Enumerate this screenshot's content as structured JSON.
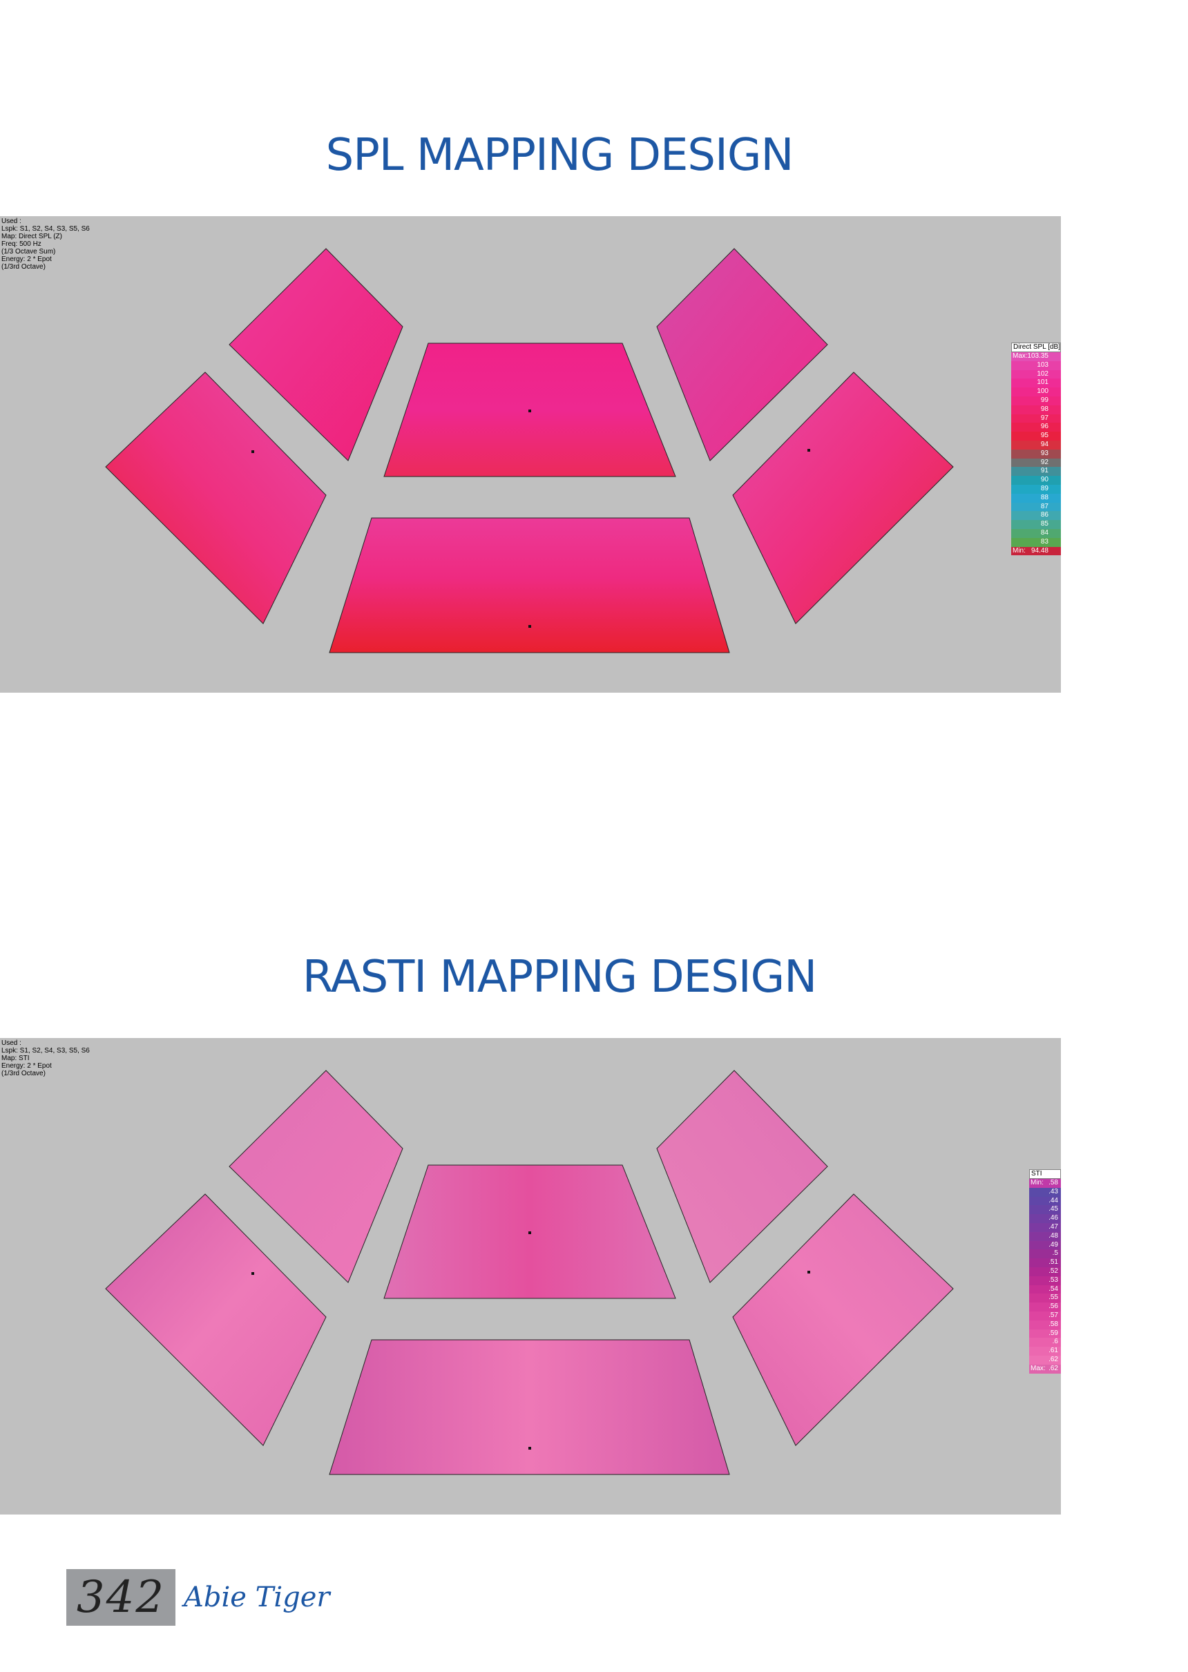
{
  "spl": {
    "title": "SPL MAPPING DESIGN",
    "info": [
      "Used :",
      "Lspk: S1, S2, S4, S3, S5, S6",
      "Map: Direct SPL (Z)",
      "Freq: 500 Hz",
      "(1/3 Octave Sum)",
      "Energy: 2 * Epot",
      "(1/3rd Octave)"
    ],
    "legend": {
      "title": "Direct SPL [dB]",
      "rows": [
        {
          "label": "Max:",
          "value": "103.35",
          "color": "#e34fb4"
        },
        {
          "label": "",
          "value": "103",
          "color": "#e840a8"
        },
        {
          "label": "",
          "value": "102",
          "color": "#ec36a0"
        },
        {
          "label": "",
          "value": "101",
          "color": "#ef2c96"
        },
        {
          "label": "",
          "value": "100",
          "color": "#f0288c"
        },
        {
          "label": "",
          "value": "99",
          "color": "#f02680"
        },
        {
          "label": "",
          "value": "98",
          "color": "#ef2470"
        },
        {
          "label": "",
          "value": "97",
          "color": "#ee2260"
        },
        {
          "label": "",
          "value": "96",
          "color": "#ec2050"
        },
        {
          "label": "",
          "value": "95",
          "color": "#e92040"
        },
        {
          "label": "",
          "value": "94",
          "color": "#d83040"
        },
        {
          "label": "",
          "value": "93",
          "color": "#a04a50"
        },
        {
          "label": "",
          "value": "92",
          "color": "#707070"
        },
        {
          "label": "",
          "value": "91",
          "color": "#40909a"
        },
        {
          "label": "",
          "value": "90",
          "color": "#20a0b0"
        },
        {
          "label": "",
          "value": "89",
          "color": "#20a8c4"
        },
        {
          "label": "",
          "value": "88",
          "color": "#28a8d0"
        },
        {
          "label": "",
          "value": "87",
          "color": "#30a8c8"
        },
        {
          "label": "",
          "value": "86",
          "color": "#40a8b0"
        },
        {
          "label": "",
          "value": "85",
          "color": "#48a890"
        },
        {
          "label": "",
          "value": "84",
          "color": "#50a870"
        },
        {
          "label": "",
          "value": "83",
          "color": "#58a850"
        },
        {
          "label": "Min:",
          "value": "94.48",
          "color": "#c8243c"
        }
      ]
    }
  },
  "rasti": {
    "title": "RASTI MAPPING DESIGN",
    "info": [
      "Used :",
      "Lspk: S1, S2, S4, S3, S5, S6",
      "Map: STI",
      "Energy: 2 * Epot",
      "(1/3rd Octave)"
    ],
    "legend": {
      "title": "STI",
      "rows": [
        {
          "label": "Min:",
          "value": ".58",
          "color": "#c03aa8"
        },
        {
          "label": "",
          "value": ".43",
          "color": "#5a4aa8"
        },
        {
          "label": "",
          "value": ".44",
          "color": "#6046a8"
        },
        {
          "label": "",
          "value": ".45",
          "color": "#6842a6"
        },
        {
          "label": "",
          "value": ".46",
          "color": "#723ea4"
        },
        {
          "label": "",
          "value": ".47",
          "color": "#7c3aa2"
        },
        {
          "label": "",
          "value": ".48",
          "color": "#86369e"
        },
        {
          "label": "",
          "value": ".49",
          "color": "#90329a"
        },
        {
          "label": "",
          "value": ".5",
          "color": "#9a2e96"
        },
        {
          "label": "",
          "value": ".51",
          "color": "#a42a94"
        },
        {
          "label": "",
          "value": ".52",
          "color": "#b02892"
        },
        {
          "label": "",
          "value": ".53",
          "color": "#bc2a92"
        },
        {
          "label": "",
          "value": ".54",
          "color": "#c82e94"
        },
        {
          "label": "",
          "value": ".55",
          "color": "#d03496"
        },
        {
          "label": "",
          "value": ".56",
          "color": "#d83c9c"
        },
        {
          "label": "",
          "value": ".57",
          "color": "#de44a0"
        },
        {
          "label": "",
          "value": ".58",
          "color": "#e24ca4"
        },
        {
          "label": "",
          "value": ".59",
          "color": "#e656a8"
        },
        {
          "label": "",
          "value": ".6",
          "color": "#ea60ac"
        },
        {
          "label": "",
          "value": ".61",
          "color": "#ec68b0"
        },
        {
          "label": "",
          "value": ".62",
          "color": "#ee70b4"
        },
        {
          "label": "Max:",
          "value": ".62",
          "color": "#e064ac"
        }
      ]
    }
  },
  "footer": {
    "page_number": "342",
    "author": "Abie Tiger"
  },
  "colors": {
    "title_blue": "#1d57a4",
    "panel_grey": "#c0c0c0",
    "spl_pink": "#ee2a86",
    "spl_red": "#e92230",
    "rasti_pink": "#e876b4",
    "rasti_deep": "#d85aa6"
  }
}
